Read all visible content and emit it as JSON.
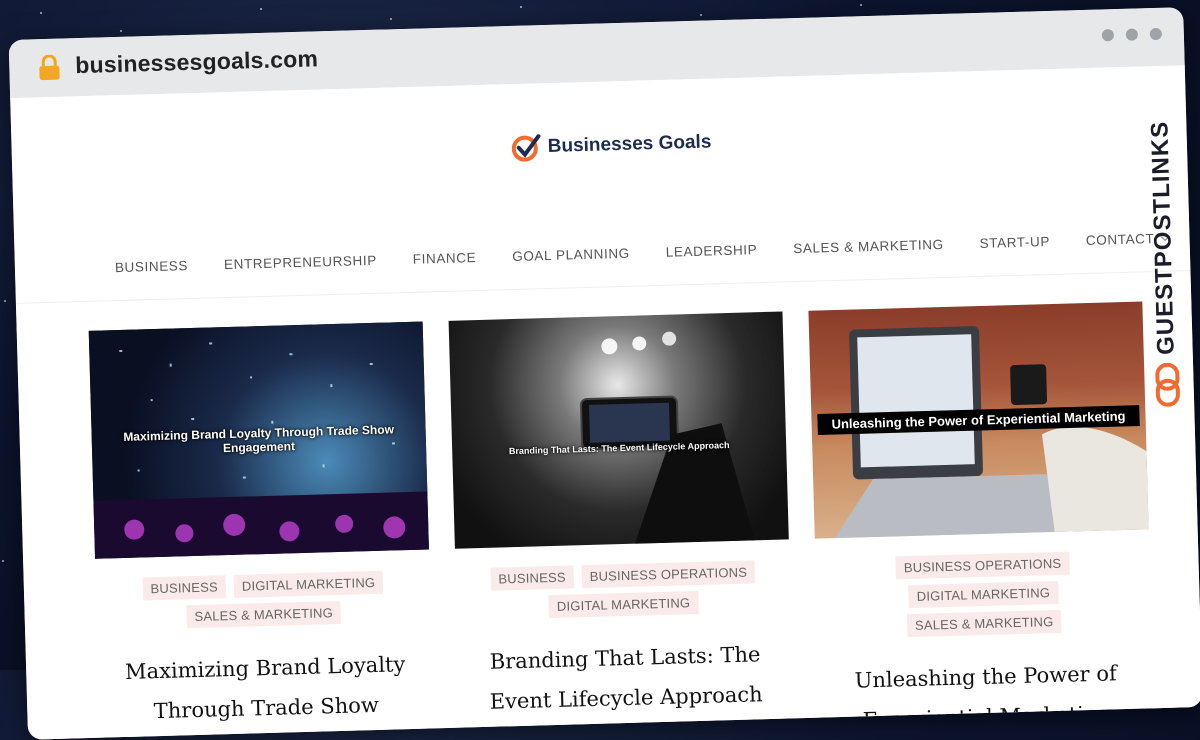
{
  "browser": {
    "url": "businessesgoals.com"
  },
  "site": {
    "logo_text": "Businesses Goals",
    "nav": [
      {
        "label": "BUSINESS"
      },
      {
        "label": "ENTREPRENEURSHIP"
      },
      {
        "label": "FINANCE"
      },
      {
        "label": "GOAL PLANNING"
      },
      {
        "label": "LEADERSHIP"
      },
      {
        "label": "SALES & MARKETING"
      },
      {
        "label": "START-UP"
      },
      {
        "label": "CONTACT",
        "has_dropdown": true
      }
    ],
    "posts": [
      {
        "image_caption": "Maximizing Brand Loyalty Through Trade Show Engagement",
        "tags": [
          "BUSINESS",
          "DIGITAL MARKETING",
          "SALES & MARKETING"
        ],
        "title": "Maximizing Brand Loyalty Through Trade Show"
      },
      {
        "image_caption": "Branding That Lasts: The Event Lifecycle Approach",
        "tags": [
          "BUSINESS",
          "BUSINESS OPERATIONS",
          "DIGITAL MARKETING"
        ],
        "title": "Branding That Lasts: The Event Lifecycle Approach"
      },
      {
        "image_caption": "Unleashing the Power of Experiential Marketing",
        "tags": [
          "BUSINESS OPERATIONS",
          "DIGITAL MARKETING",
          "SALES & MARKETING"
        ],
        "title": "Unleashing the Power of Experiential Marketing"
      }
    ]
  },
  "watermark": {
    "text": "GUESTPOSTLINKS"
  },
  "colors": {
    "accent_orange": "#f26a2e",
    "tag_bg": "#fbeaea",
    "logo_navy": "#1d2c4d"
  }
}
